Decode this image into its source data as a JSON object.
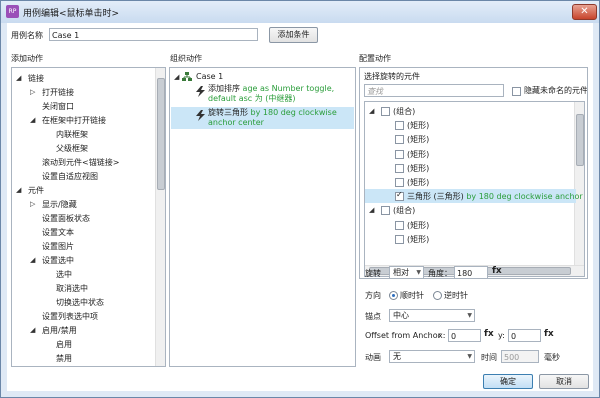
{
  "window": {
    "title": "用例编辑<鼠标单击时>",
    "app_icon": "RP",
    "close": "✕"
  },
  "case_name": {
    "label": "用例名称",
    "value": "Case 1",
    "add_condition": "添加条件"
  },
  "add_actions": {
    "heading": "添加动作",
    "items": [
      {
        "label": "链接",
        "level": 0,
        "expander": "◢"
      },
      {
        "label": "打开链接",
        "level": 1,
        "expander": "▷"
      },
      {
        "label": "关闭窗口",
        "level": 1,
        "expander": ""
      },
      {
        "label": "在框架中打开链接",
        "level": 1,
        "expander": "◢"
      },
      {
        "label": "内联框架",
        "level": 2,
        "expander": ""
      },
      {
        "label": "父级框架",
        "level": 2,
        "expander": ""
      },
      {
        "label": "滚动到元件<锚链接>",
        "level": 1,
        "expander": ""
      },
      {
        "label": "设置自适应视图",
        "level": 1,
        "expander": ""
      },
      {
        "label": "元件",
        "level": 0,
        "expander": "◢"
      },
      {
        "label": "显示/隐藏",
        "level": 1,
        "expander": "▷"
      },
      {
        "label": "设置面板状态",
        "level": 1,
        "expander": ""
      },
      {
        "label": "设置文本",
        "level": 1,
        "expander": ""
      },
      {
        "label": "设置图片",
        "level": 1,
        "expander": ""
      },
      {
        "label": "设置选中",
        "level": 1,
        "expander": "◢"
      },
      {
        "label": "选中",
        "level": 2,
        "expander": ""
      },
      {
        "label": "取消选中",
        "level": 2,
        "expander": ""
      },
      {
        "label": "切换选中状态",
        "level": 2,
        "expander": ""
      },
      {
        "label": "设置列表选中项",
        "level": 1,
        "expander": ""
      },
      {
        "label": "启用/禁用",
        "level": 1,
        "expander": "◢"
      },
      {
        "label": "启用",
        "level": 2,
        "expander": ""
      },
      {
        "label": "禁用",
        "level": 2,
        "expander": ""
      }
    ]
  },
  "organize": {
    "heading": "组织动作",
    "case_label": "Case 1",
    "case_expander": "◢",
    "action1": {
      "prefix": "添加排序 ",
      "detail": "age as Number toggle, default asc 为 (中继器)"
    },
    "action2": {
      "prefix": "旋转三角形 ",
      "detail": "by 180 deg clockwise anchor center"
    }
  },
  "configure": {
    "heading": "配置动作",
    "subheading": "选择旋转的元件",
    "search_placeholder": "查找",
    "hide_unnamed": "隐藏未命名的元件",
    "tree": [
      {
        "label": "(组合)",
        "level": 0,
        "expander": "◢",
        "checked": false,
        "detail": ""
      },
      {
        "label": "(矩形)",
        "level": 1,
        "expander": "",
        "checked": false,
        "detail": ""
      },
      {
        "label": "(矩形)",
        "level": 1,
        "expander": "",
        "checked": false,
        "detail": ""
      },
      {
        "label": "(矩形)",
        "level": 1,
        "expander": "",
        "checked": false,
        "detail": ""
      },
      {
        "label": "(矩形)",
        "level": 1,
        "expander": "",
        "checked": false,
        "detail": ""
      },
      {
        "label": "(矩形)",
        "level": 1,
        "expander": "",
        "checked": false,
        "detail": ""
      },
      {
        "label": "三角形 (三角形)",
        "level": 1,
        "expander": "",
        "checked": true,
        "detail": " by 180 deg clockwise anchor cente"
      },
      {
        "label": "(组合)",
        "level": 0,
        "expander": "◢",
        "checked": false,
        "detail": ""
      },
      {
        "label": "(矩形)",
        "level": 1,
        "expander": "",
        "checked": false,
        "detail": ""
      },
      {
        "label": "(矩形)",
        "level": 1,
        "expander": "",
        "checked": false,
        "detail": ""
      }
    ],
    "hscroll_grip": "III",
    "rotate_label": "旋转",
    "rotate_mode": "相对",
    "angle_label": "角度：",
    "angle_value": "180",
    "fx": "fx",
    "direction_label": "方向",
    "dir_cw": "顺时针",
    "dir_ccw": "逆时针",
    "anchor_label": "锚点",
    "anchor_value": "中心",
    "offset_label": "Offset from Anchor",
    "x_label": "x:",
    "x_value": "0",
    "y_label": "y:",
    "y_value": "0",
    "anim_label": "动画",
    "anim_value": "无",
    "time_label": "时间",
    "time_value": "500",
    "ms_label": "毫秒"
  },
  "footer": {
    "ok": "确定",
    "cancel": "取消"
  },
  "colors": {
    "accent": "#2f6fbf",
    "selection": "#cbe6f7",
    "green_text": "#2a9d3a"
  }
}
